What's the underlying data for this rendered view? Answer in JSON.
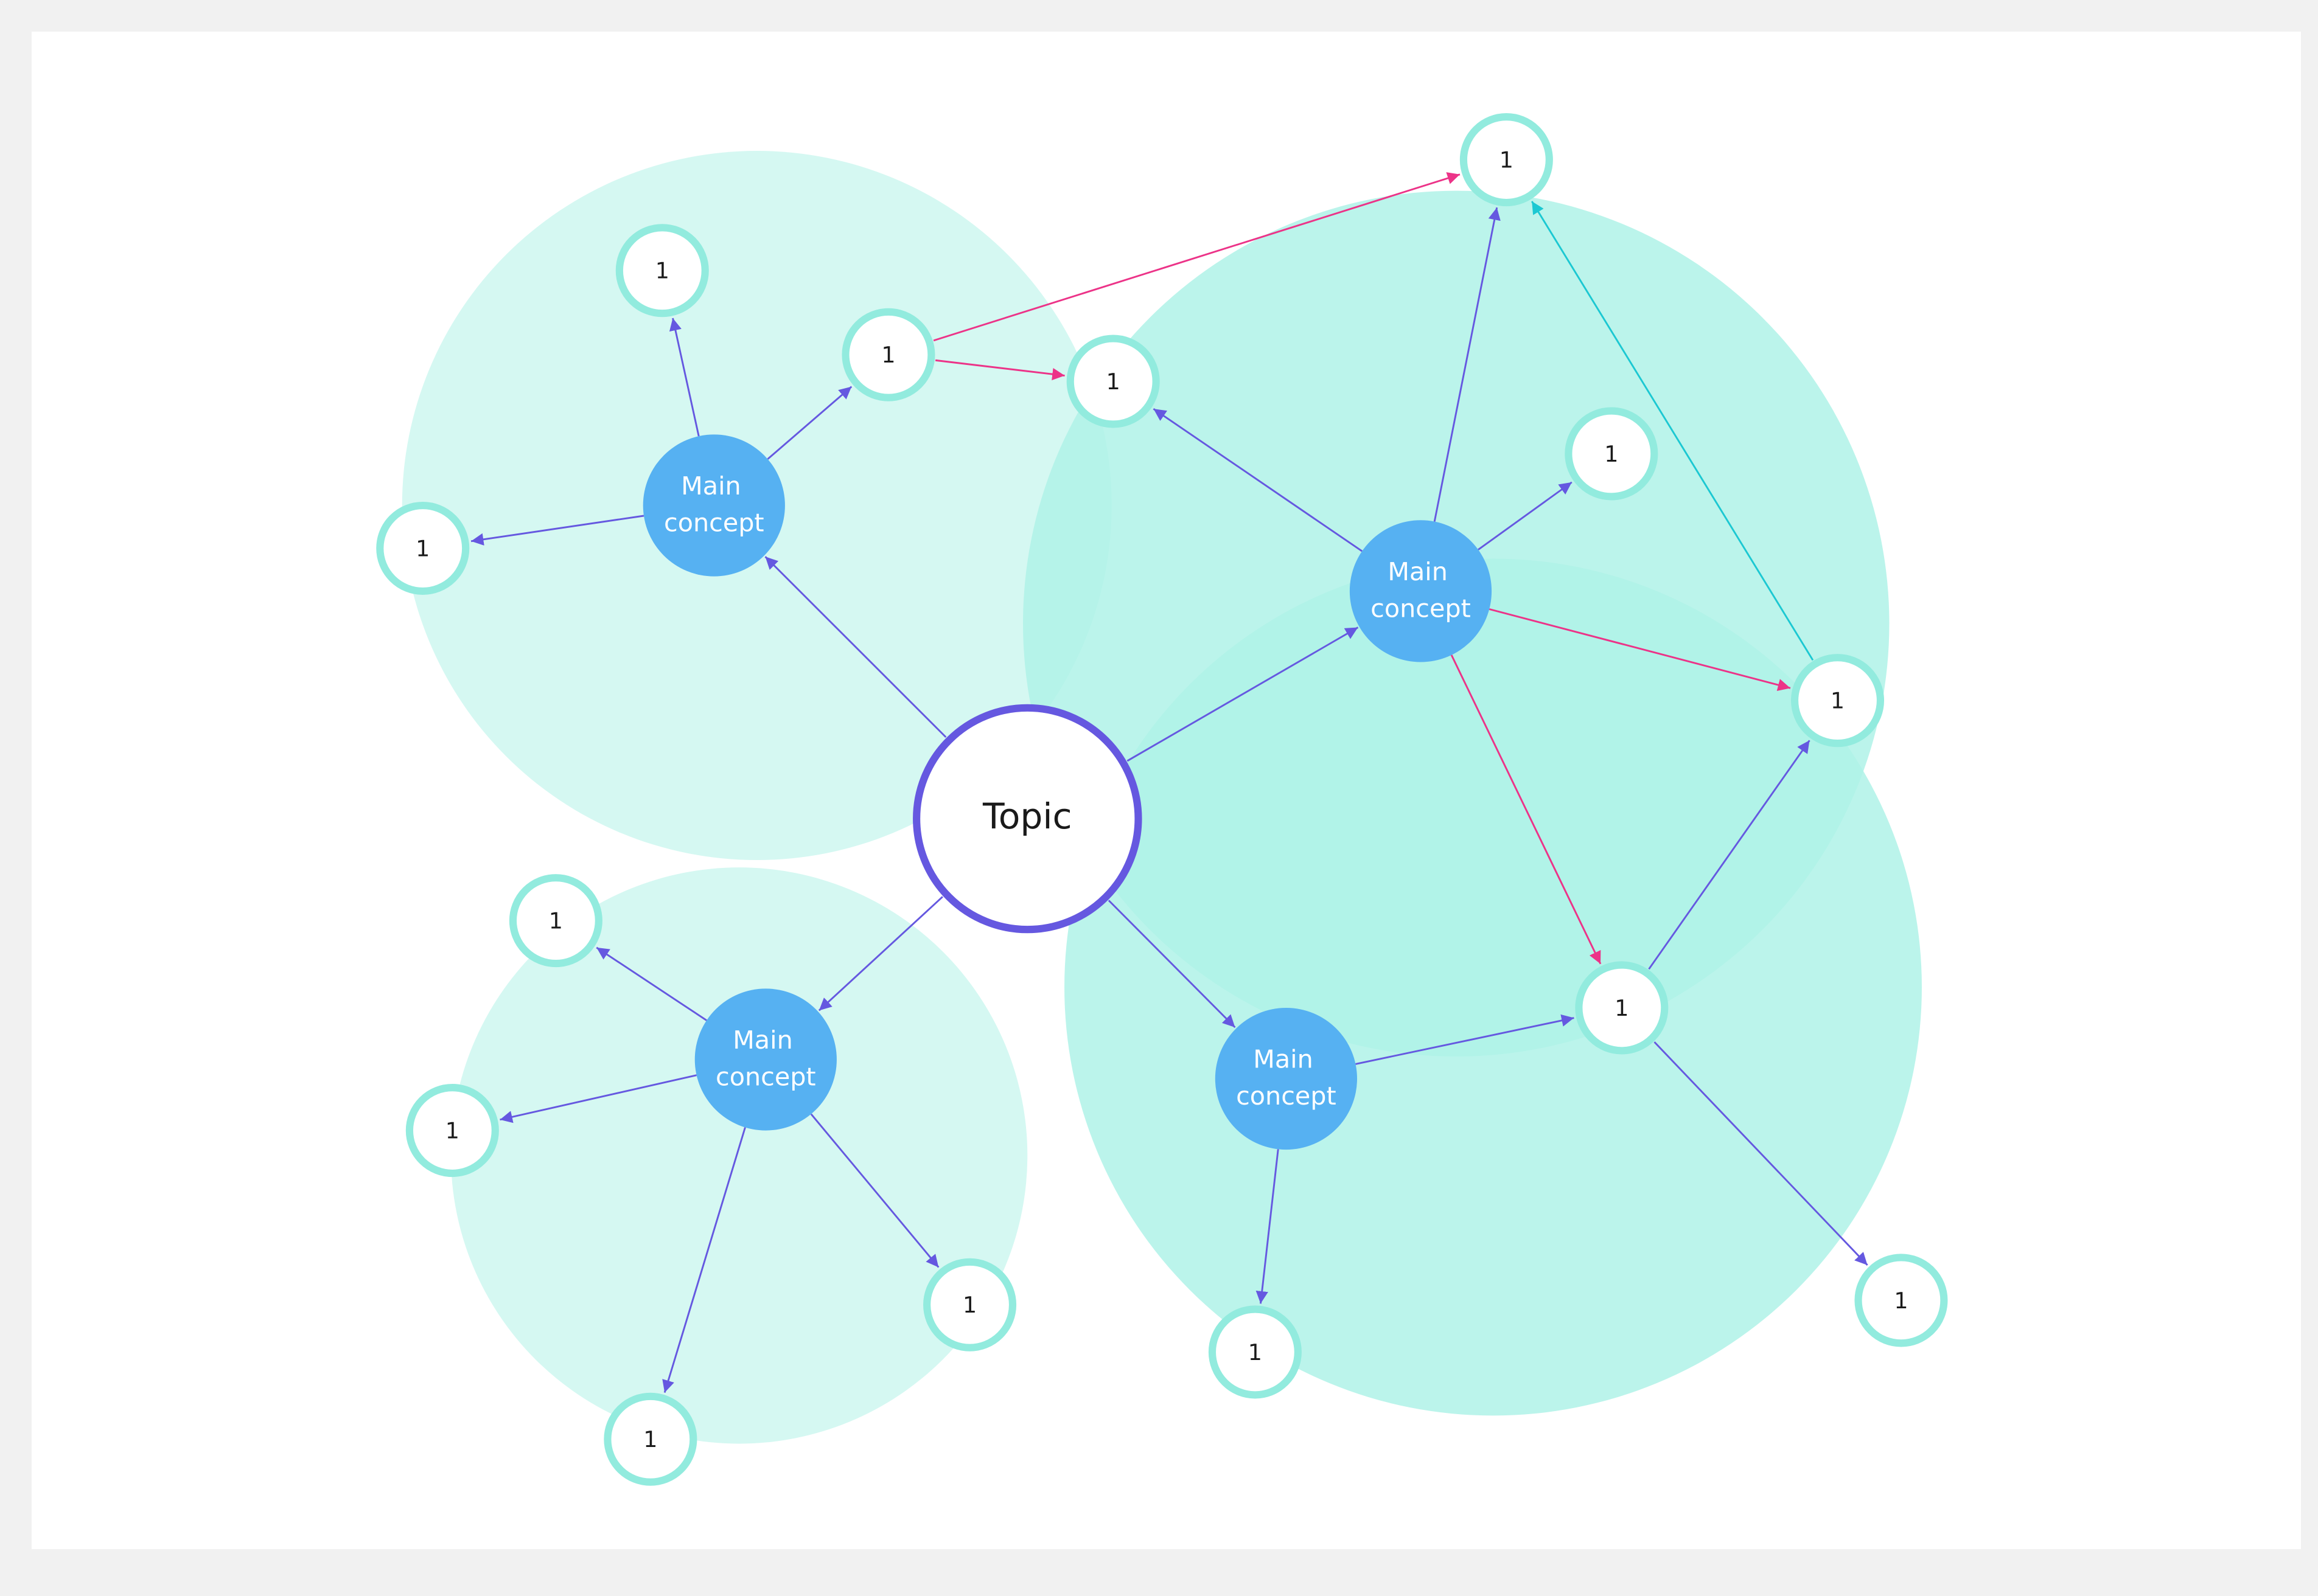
{
  "diagram": {
    "type": "concept-map",
    "colors": {
      "background": "#f1f1f1",
      "canvas": "#ffffff",
      "topic_stroke": "#6558e0",
      "main_concept_fill": "#56b1f2",
      "leaf_stroke": "#92ebde",
      "group_fill_light": "#d5f8f2",
      "group_fill_medium": "#b4f2e9",
      "edge_default": "#6558e0",
      "edge_cross": "#ec3388",
      "edge_cyan": "#1cc8d2"
    },
    "topic": {
      "id": "topic",
      "label": "Topic"
    },
    "main_concepts": [
      {
        "id": "mc1",
        "line1": "Main",
        "line2": "concept"
      },
      {
        "id": "mc2",
        "line1": "Main",
        "line2": "concept"
      },
      {
        "id": "mc3",
        "line1": "Main",
        "line2": "concept"
      },
      {
        "id": "mc4",
        "line1": "Main",
        "line2": "concept"
      }
    ],
    "leaves": [
      {
        "id": "l1",
        "label": "1",
        "group": "mc1"
      },
      {
        "id": "l2",
        "label": "1",
        "group": "mc1"
      },
      {
        "id": "l3",
        "label": "1",
        "group": "mc1"
      },
      {
        "id": "l4",
        "label": "1",
        "group": "mc2"
      },
      {
        "id": "l5",
        "label": "1",
        "group": "mc2"
      },
      {
        "id": "l6",
        "label": "1",
        "group": "mc2"
      },
      {
        "id": "l7",
        "label": "1",
        "group": "mc2"
      },
      {
        "id": "l8",
        "label": "1",
        "group": "mc4"
      },
      {
        "id": "l9",
        "label": "1",
        "group": "mc3"
      },
      {
        "id": "l10",
        "label": "1",
        "group": "mc3"
      },
      {
        "id": "l11",
        "label": "1",
        "group": "mc3"
      },
      {
        "id": "l12",
        "label": "1",
        "group": "mc3"
      },
      {
        "id": "l13",
        "label": "1",
        "group": "mc4"
      },
      {
        "id": "l14",
        "label": "1",
        "group": "mc4"
      }
    ],
    "edges": [
      {
        "from": "topic",
        "to": "mc1",
        "kind": "default"
      },
      {
        "from": "topic",
        "to": "mc2",
        "kind": "default"
      },
      {
        "from": "topic",
        "to": "mc3",
        "kind": "default"
      },
      {
        "from": "topic",
        "to": "mc4",
        "kind": "default"
      },
      {
        "from": "mc1",
        "to": "l1",
        "kind": "default"
      },
      {
        "from": "mc1",
        "to": "l2",
        "kind": "default"
      },
      {
        "from": "mc1",
        "to": "l3",
        "kind": "default"
      },
      {
        "from": "mc2",
        "to": "l4",
        "kind": "default"
      },
      {
        "from": "mc2",
        "to": "l5",
        "kind": "default"
      },
      {
        "from": "mc2",
        "to": "l6",
        "kind": "default"
      },
      {
        "from": "mc2",
        "to": "l7",
        "kind": "cross"
      },
      {
        "from": "mc2",
        "to": "l8",
        "kind": "cross"
      },
      {
        "from": "mc3",
        "to": "l9",
        "kind": "default"
      },
      {
        "from": "mc3",
        "to": "l10",
        "kind": "default"
      },
      {
        "from": "mc3",
        "to": "l11",
        "kind": "default"
      },
      {
        "from": "mc3",
        "to": "l12",
        "kind": "default"
      },
      {
        "from": "mc4",
        "to": "l13",
        "kind": "default"
      },
      {
        "from": "mc4",
        "to": "l8",
        "kind": "default"
      },
      {
        "from": "l8",
        "to": "l7",
        "kind": "default"
      },
      {
        "from": "l8",
        "to": "l14",
        "kind": "default"
      },
      {
        "from": "l3",
        "to": "l4",
        "kind": "cross"
      },
      {
        "from": "l3",
        "to": "l6",
        "kind": "cross"
      },
      {
        "from": "l7",
        "to": "l4",
        "kind": "cyan"
      }
    ]
  }
}
